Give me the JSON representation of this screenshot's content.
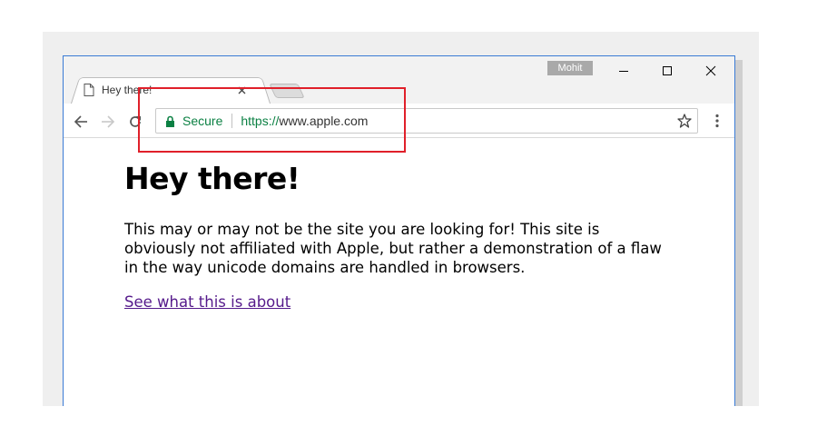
{
  "window": {
    "profile_name": "Mohit",
    "tab": {
      "title": "Hey there!"
    }
  },
  "toolbar": {
    "security_label": "Secure",
    "url_scheme": "https://",
    "url_host": "www.apple.com"
  },
  "page": {
    "heading": "Hey there!",
    "paragraph": "This may or may not be the site you are looking for! This site is obviously not affiliated with Apple, but rather a demonstration of a flaw in the way unicode domains are handled in browsers.",
    "link_text": "See what this is about"
  },
  "icons": {
    "tab_favicon": "page-icon",
    "tab_close": "close-icon",
    "back": "arrow-left-icon",
    "forward": "arrow-right-icon",
    "reload": "reload-icon",
    "lock": "lock-icon",
    "bookmark": "star-icon",
    "menu": "kebab-menu-icon",
    "minimize": "minimize-icon",
    "maximize": "maximize-icon",
    "close_window": "close-icon"
  },
  "colors": {
    "secure_green": "#0b8043",
    "visited_link": "#551a8b",
    "annotation_red": "#e0202a",
    "window_border": "#3a7bd5"
  }
}
